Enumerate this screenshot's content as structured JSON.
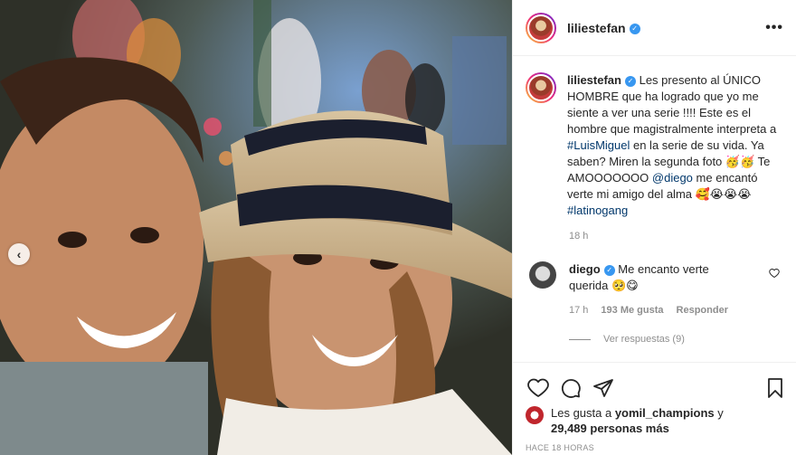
{
  "post": {
    "username": "liliestefan",
    "more_label": "•••"
  },
  "caption": {
    "username": "liliestefan",
    "part1": "Les presento al ÚNICO HOMBRE que ha logrado que yo me siente a ver una serie !!!! Este es el hombre que magistralmente interpreta a ",
    "hashtag1": "#LuisMiguel",
    "part2": " en la serie de su vida. Ya saben? Miren la segunda foto ",
    "emoji1": "🥳🥳",
    "part3": " Te AMOOOOOOO ",
    "mention": "@diego",
    "part4": " me encantó verte mi amigo del alma ",
    "emoji2": "🥰😭😭😭",
    "hashtag2": "#latinogang",
    "time": "18 h"
  },
  "comment": {
    "username": "diego",
    "text": "Me encanto verte querida ",
    "emoji": "🥺😋",
    "time": "17 h",
    "likes": "193 Me gusta",
    "reply": "Responder",
    "view_replies": "Ver respuestas (9)"
  },
  "likes": {
    "prefix": "Les gusta a ",
    "user": "yomil_champions",
    "middle": " y",
    "count": "29,489 personas más"
  },
  "footer": {
    "ago": "HACE 18 HORAS"
  },
  "icons": {
    "carousel_prev": "‹",
    "like": "heart-icon",
    "comment": "comment-icon",
    "share": "paper-plane-icon",
    "save": "bookmark-icon"
  },
  "colors": {
    "link": "#00376b",
    "verified": "#3897f0",
    "muted": "#8e8e8e"
  }
}
